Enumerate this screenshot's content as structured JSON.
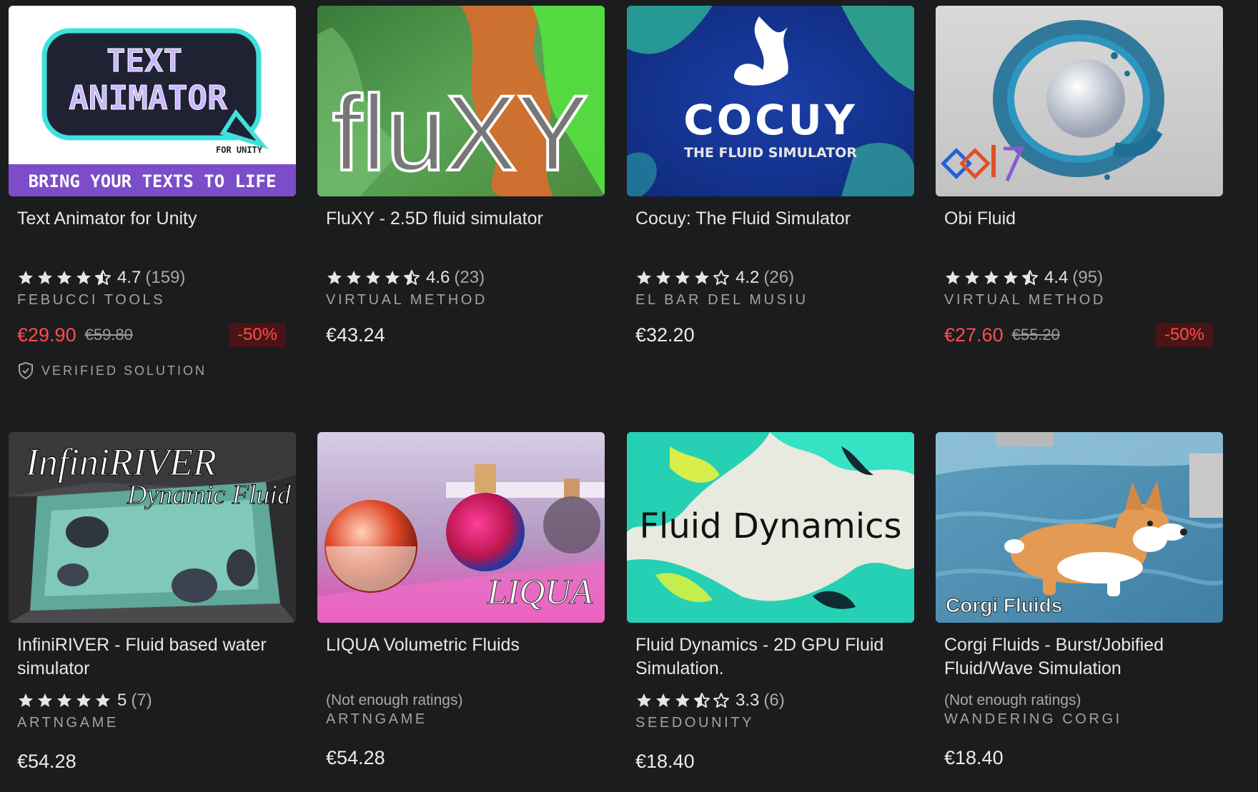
{
  "products": [
    {
      "title": "Text Animator for Unity",
      "thumb_text": [
        "TEXT",
        "ANIMATOR",
        "FOR UNITY",
        "BRING YOUR TEXTS TO LIFE"
      ],
      "rating": {
        "stars": 4.5,
        "score": "4.7",
        "count": "(159)"
      },
      "publisher": "FEBUCCI TOOLS",
      "price": "€29.90",
      "original_price": "€59.80",
      "discount": "-50%",
      "badge": "VERIFIED SOLUTION"
    },
    {
      "title": "FluXY - 2.5D fluid simulator",
      "thumb_text": [
        "fluXY"
      ],
      "rating": {
        "stars": 4.5,
        "score": "4.6",
        "count": "(23)"
      },
      "publisher": "VIRTUAL METHOD",
      "price": "€43.24"
    },
    {
      "title": "Cocuy: The Fluid Simulator",
      "thumb_text": [
        "COCUY",
        "THE FLUID SIMULATOR"
      ],
      "rating": {
        "stars": 4,
        "score": "4.2",
        "count": "(26)"
      },
      "publisher": "EL BAR DEL MUSIU",
      "price": "€32.20"
    },
    {
      "title": "Obi Fluid",
      "thumb_text": [],
      "rating": {
        "stars": 4.5,
        "score": "4.4",
        "count": "(95)"
      },
      "publisher": "VIRTUAL METHOD",
      "price": "€27.60",
      "original_price": "€55.20",
      "discount": "-50%"
    },
    {
      "title": "InfiniRIVER - Fluid based water simulator",
      "thumb_text": [
        "InfiniRIVER",
        "Dynamic Fluid"
      ],
      "rating": {
        "stars": 5,
        "score": "5",
        "count": "(7)"
      },
      "publisher": "ARTNGAME",
      "price": "€54.28"
    },
    {
      "title": "LIQUA Volumetric Fluids",
      "thumb_text": [
        "LIQUA"
      ],
      "no_ratings": "(Not enough ratings)",
      "publisher": "ARTNGAME",
      "price": "€54.28"
    },
    {
      "title": "Fluid Dynamics - 2D GPU Fluid Simulation.",
      "thumb_text": [
        "Fluid Dynamics"
      ],
      "rating": {
        "stars": 3.5,
        "score": "3.3",
        "count": "(6)"
      },
      "publisher": "SEEDOUNITY",
      "price": "€18.40"
    },
    {
      "title": "Corgi Fluids - Burst/Jobified Fluid/Wave Simulation",
      "thumb_text": [
        "Corgi Fluids"
      ],
      "no_ratings": "(Not enough ratings)",
      "publisher": "WANDERING CORGI",
      "price": "€18.40"
    }
  ],
  "colors": {
    "background": "#1b1c1e",
    "sale_price": "#ff4d4d",
    "discount_bg": "#4a1416"
  }
}
